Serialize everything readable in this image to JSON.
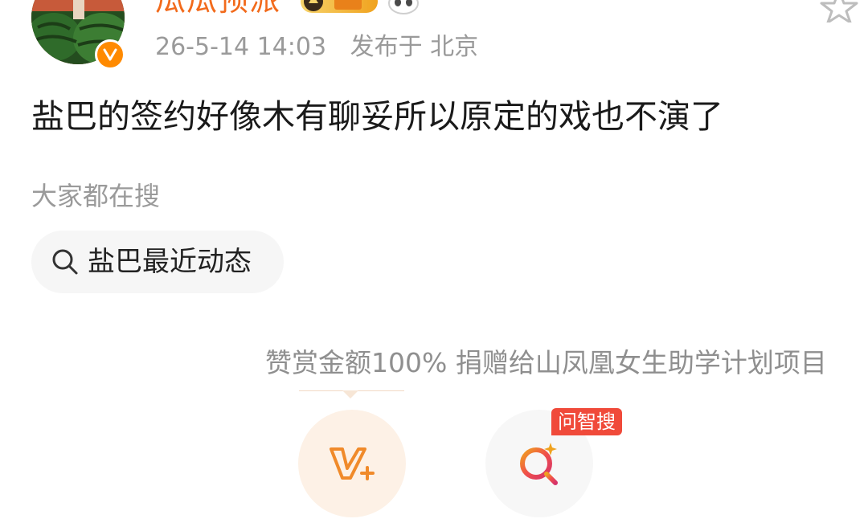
{
  "post": {
    "author": {
      "name": "瓜瓜预派",
      "verified": true,
      "badge_color": "#ff8a00",
      "name_color": "#f26a1b"
    },
    "timestamp": "26-5-14 14:03",
    "location": "发布于 北京",
    "text": "盐巴的签约好像木有聊妥所以原定的戏也不演了"
  },
  "related_search": {
    "title": "大家都在搜",
    "items": [
      {
        "label": "盐巴最近动态",
        "icon": "search-icon"
      }
    ]
  },
  "reward": {
    "note": "赞赏金额100% 捐赠给山凤凰女生助学计划项目",
    "buttons": [
      {
        "name": "reward-vplus",
        "icon": "v-plus-icon"
      },
      {
        "name": "ai-search",
        "icon": "ai-search-icon",
        "tag": "问智搜"
      }
    ]
  },
  "colors": {
    "accent_orange": "#ff8a00",
    "tag_red": "#f04a3a"
  }
}
